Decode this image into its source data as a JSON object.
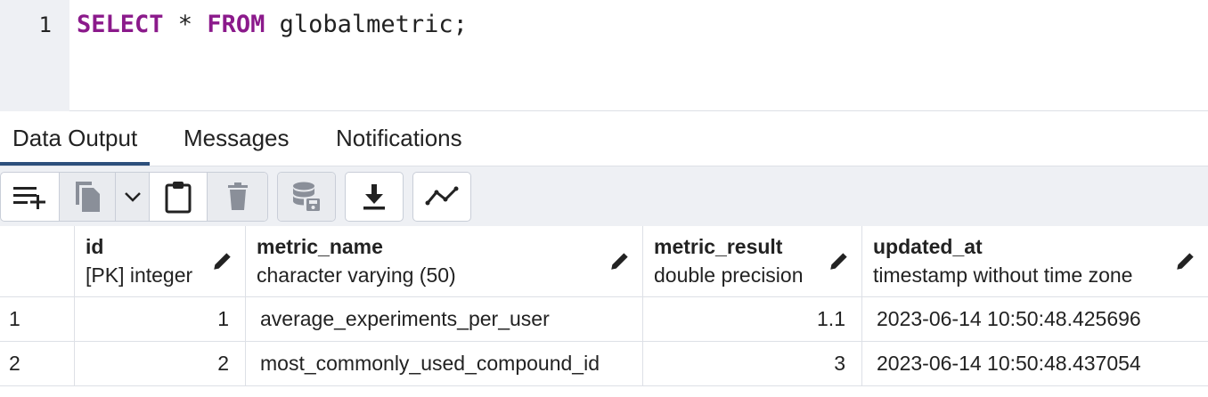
{
  "editor": {
    "line_number": "1",
    "code": {
      "kw1": "SELECT",
      "star": " * ",
      "kw2": "FROM",
      "rest": " globalmetric;"
    }
  },
  "tabs": [
    {
      "label": "Data Output",
      "active": true
    },
    {
      "label": "Messages",
      "active": false
    },
    {
      "label": "Notifications",
      "active": false
    }
  ],
  "toolbar": {
    "icons": [
      "add-row-icon",
      "copy-icon",
      "chevron-down-icon",
      "paste-icon",
      "delete-icon",
      "save-data-icon",
      "download-icon",
      "graph-icon"
    ]
  },
  "grid": {
    "columns": [
      {
        "name": "id",
        "type": "[PK] integer"
      },
      {
        "name": "metric_name",
        "type": "character varying (50)"
      },
      {
        "name": "metric_result",
        "type": "double precision"
      },
      {
        "name": "updated_at",
        "type": "timestamp without time zone"
      }
    ],
    "rows": [
      {
        "rownum": "1",
        "id": "1",
        "metric_name": "average_experiments_per_user",
        "metric_result": "1.1",
        "updated_at": "2023-06-14 10:50:48.425696"
      },
      {
        "rownum": "2",
        "id": "2",
        "metric_name": "most_commonly_used_compound_id",
        "metric_result": "3",
        "updated_at": "2023-06-14 10:50:48.437054"
      }
    ]
  },
  "colors": {
    "keyword": "#8b1a8b",
    "tab_underline": "#2c4f7c",
    "toolbar_bg": "#eef0f4"
  }
}
